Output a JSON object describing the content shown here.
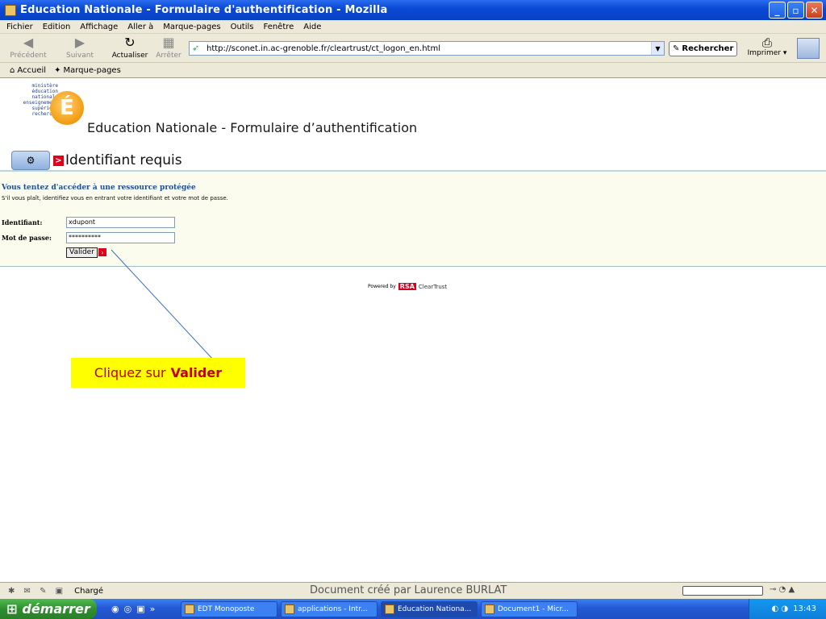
{
  "window": {
    "title": "Education Nationale - Formulaire d'authentification - Mozilla"
  },
  "menu": [
    "Fichier",
    "Edition",
    "Affichage",
    "Aller à",
    "Marque-pages",
    "Outils",
    "Fenêtre",
    "Aide"
  ],
  "nav": {
    "back_label": "Précédent",
    "forward_label": "Suivant",
    "reload_label": "Actualiser",
    "stop_label": "Arrêter",
    "url": "http://sconet.in.ac-grenoble.fr/cleartrust/ct_logon_en.html",
    "search_label": "Rechercher",
    "print_label": "Imprimer"
  },
  "bookmarks": [
    "Accueil",
    "Marque-pages"
  ],
  "page": {
    "ministry_lines": [
      "ministère",
      "éducation",
      "nationale",
      "enseignement",
      "supérieur",
      "recherche"
    ],
    "logo_letter": "É",
    "title": "Education Nationale - Formulaire d’authentification",
    "section_title": "Identifiant requis",
    "section_arrow": ">",
    "warning_title": "Vous tentez d'accéder à une ressource protégée",
    "warning_text": "S'il vous plaît, identifiez vous en entrant votre identifiant et votre mot de passe.",
    "username_label": "Identifiant:",
    "username_value": "xdupont",
    "password_label": "Mot de passe:",
    "password_value": "**********",
    "submit_label": "Valider",
    "powered_by": "Powered by",
    "rsa": "RSA",
    "cleartrust": "ClearTrust"
  },
  "callout": {
    "prefix": "Cliquez sur",
    "target": "Valider",
    "bg_color": "#ffff00",
    "text_color": "#c00000"
  },
  "status": {
    "text": "Chargé",
    "document_credit": "Document créé par Laurence BURLAT"
  },
  "taskbar": {
    "start_label": "démarrer",
    "tasks": [
      {
        "label": "EDT Monoposte"
      },
      {
        "label": "applications - Intr..."
      },
      {
        "label": "Education Nationa..."
      },
      {
        "label": "Document1 - Micr..."
      }
    ],
    "clock": "13:43"
  }
}
